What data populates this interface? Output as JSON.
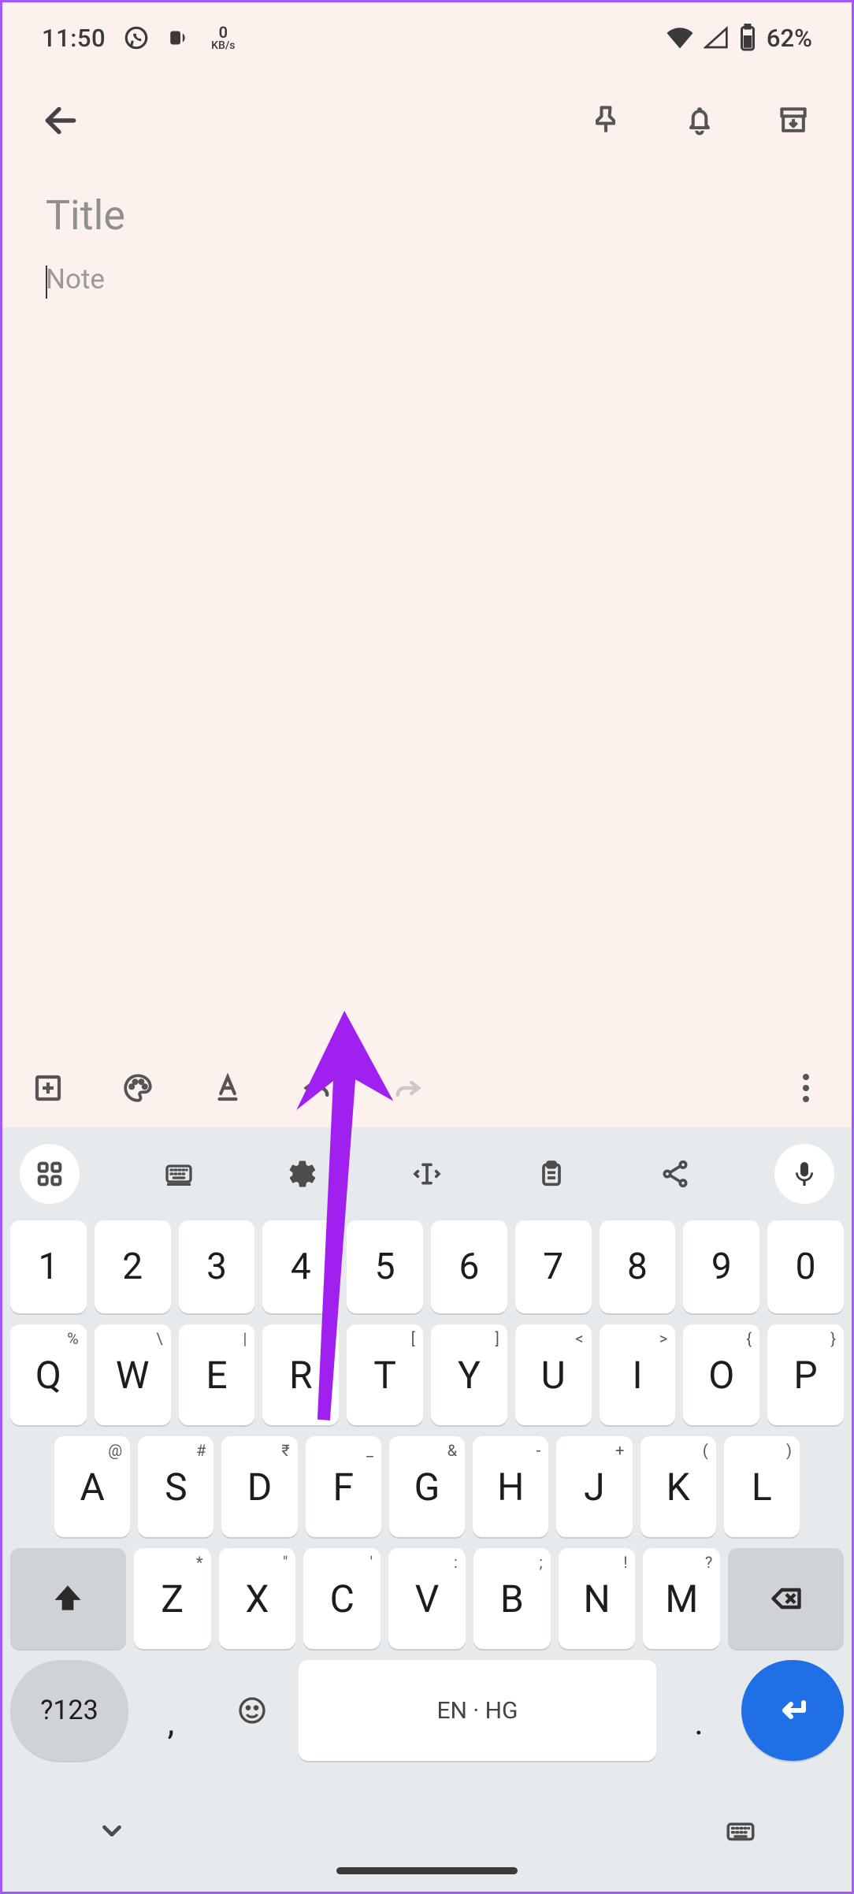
{
  "status_bar": {
    "time": "11:50",
    "data_rate_value": "0",
    "data_rate_unit": "KB/s",
    "battery_pct": "62%"
  },
  "note": {
    "title_placeholder": "Title",
    "body_placeholder": "Note"
  },
  "keyboard": {
    "row1": [
      "1",
      "2",
      "3",
      "4",
      "5",
      "6",
      "7",
      "8",
      "9",
      "0"
    ],
    "row2": [
      {
        "k": "Q",
        "h": "%"
      },
      {
        "k": "W",
        "h": "\\"
      },
      {
        "k": "E",
        "h": "|"
      },
      {
        "k": "R",
        "h": "="
      },
      {
        "k": "T",
        "h": "["
      },
      {
        "k": "Y",
        "h": "]"
      },
      {
        "k": "U",
        "h": "<"
      },
      {
        "k": "I",
        "h": ">"
      },
      {
        "k": "O",
        "h": "{"
      },
      {
        "k": "P",
        "h": "}"
      }
    ],
    "row3": [
      {
        "k": "A",
        "h": "@"
      },
      {
        "k": "S",
        "h": "#"
      },
      {
        "k": "D",
        "h": "₹"
      },
      {
        "k": "F",
        "h": "_"
      },
      {
        "k": "G",
        "h": "&"
      },
      {
        "k": "H",
        "h": "-"
      },
      {
        "k": "J",
        "h": "+"
      },
      {
        "k": "K",
        "h": "("
      },
      {
        "k": "L",
        "h": ")"
      }
    ],
    "row4": [
      {
        "k": "Z",
        "h": "*"
      },
      {
        "k": "X",
        "h": "\""
      },
      {
        "k": "C",
        "h": "'"
      },
      {
        "k": "V",
        "h": ":"
      },
      {
        "k": "B",
        "h": ";"
      },
      {
        "k": "N",
        "h": "!"
      },
      {
        "k": "M",
        "h": "?"
      }
    ],
    "num_shift_label": "?123",
    "comma_label": ",",
    "space_label": "EN · HG",
    "period_label": "."
  }
}
